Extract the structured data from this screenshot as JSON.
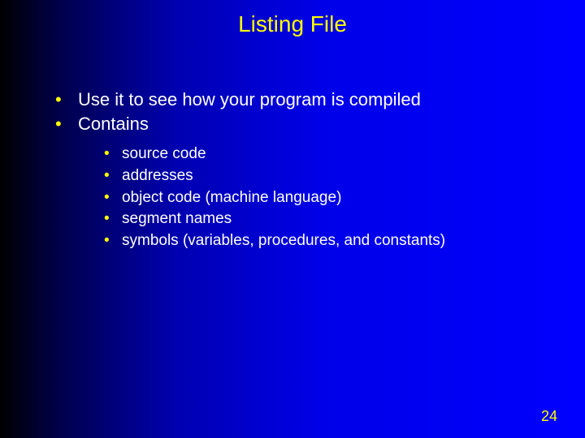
{
  "title": "Listing File",
  "bullets": [
    "Use it to see how your program is compiled",
    "Contains"
  ],
  "sub_bullets": [
    "source code",
    "addresses",
    "object code (machine language)",
    "segment names",
    "symbols (variables, procedures, and constants)"
  ],
  "page_number": "24"
}
